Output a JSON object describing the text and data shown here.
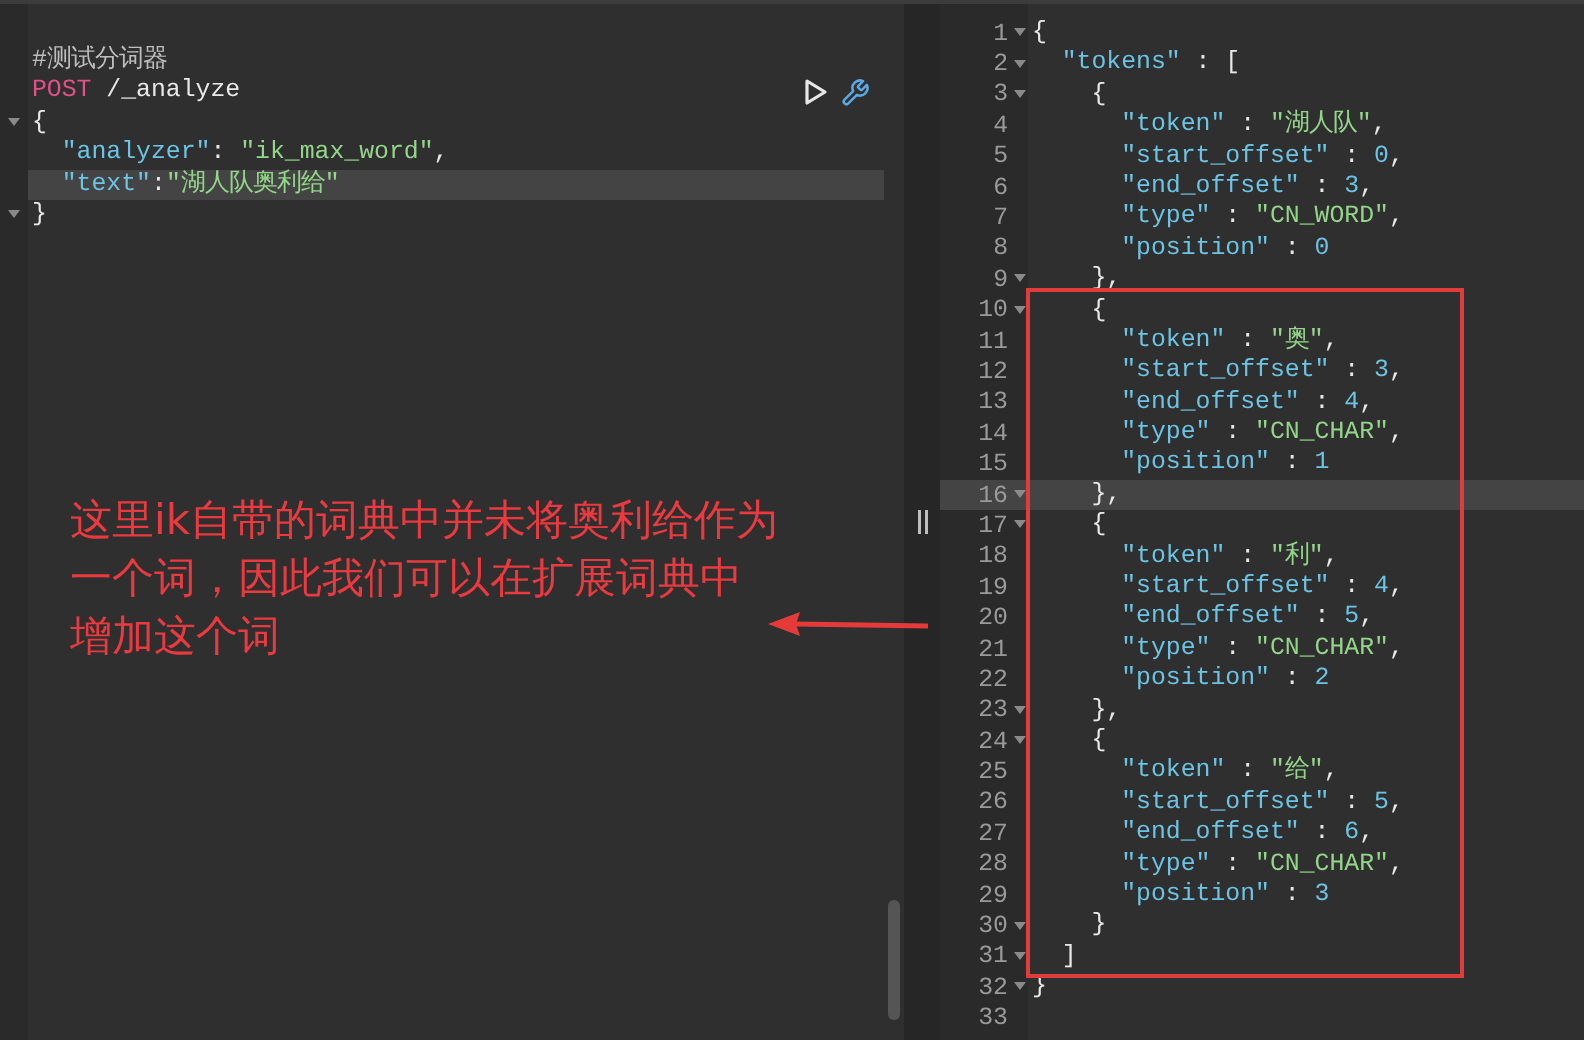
{
  "request": {
    "lines": [
      {
        "fold": false,
        "active": false,
        "parts": [
          {
            "kind": "comment",
            "text": "#测试分词器"
          }
        ]
      },
      {
        "fold": false,
        "active": false,
        "parts": [
          {
            "kind": "method",
            "text": "POST"
          },
          {
            "kind": "punct",
            "text": " /_analyze"
          }
        ]
      },
      {
        "fold": true,
        "active": false,
        "parts": [
          {
            "kind": "punct",
            "text": "{"
          }
        ]
      },
      {
        "fold": false,
        "active": false,
        "parts": [
          {
            "kind": "key",
            "text": "  \"analyzer\""
          },
          {
            "kind": "punct",
            "text": ": "
          },
          {
            "kind": "string",
            "text": "\"ik_max_word\""
          },
          {
            "kind": "punct",
            "text": ","
          }
        ]
      },
      {
        "fold": false,
        "active": true,
        "parts": [
          {
            "kind": "key",
            "text": "  \"text\""
          },
          {
            "kind": "punct",
            "text": ":"
          },
          {
            "kind": "string",
            "text": "\"湖人队奥利给\""
          }
        ]
      },
      {
        "fold": true,
        "active": false,
        "parts": [
          {
            "kind": "punct",
            "text": "}"
          }
        ]
      }
    ]
  },
  "annotation": {
    "lines": [
      "这里ik自带的词典中并未将奥利给作为",
      "一个词，因此我们可以在扩展词典中",
      "增加这个词"
    ]
  },
  "response": {
    "lines": [
      {
        "n": "1",
        "fold": true,
        "active": false,
        "parts": [
          {
            "kind": "punct",
            "text": "{"
          }
        ]
      },
      {
        "n": "2",
        "fold": true,
        "active": false,
        "parts": [
          {
            "kind": "key",
            "text": "  \"tokens\""
          },
          {
            "kind": "punct",
            "text": " : ["
          }
        ]
      },
      {
        "n": "3",
        "fold": true,
        "active": false,
        "parts": [
          {
            "kind": "punct",
            "text": "    {"
          }
        ]
      },
      {
        "n": "4",
        "fold": false,
        "active": false,
        "parts": [
          {
            "kind": "key",
            "text": "      \"token\""
          },
          {
            "kind": "punct",
            "text": " : "
          },
          {
            "kind": "string",
            "text": "\"湖人队\""
          },
          {
            "kind": "punct",
            "text": ","
          }
        ]
      },
      {
        "n": "5",
        "fold": false,
        "active": false,
        "parts": [
          {
            "kind": "key",
            "text": "      \"start_offset\""
          },
          {
            "kind": "punct",
            "text": " : "
          },
          {
            "kind": "number",
            "text": "0"
          },
          {
            "kind": "punct",
            "text": ","
          }
        ]
      },
      {
        "n": "6",
        "fold": false,
        "active": false,
        "parts": [
          {
            "kind": "key",
            "text": "      \"end_offset\""
          },
          {
            "kind": "punct",
            "text": " : "
          },
          {
            "kind": "number",
            "text": "3"
          },
          {
            "kind": "punct",
            "text": ","
          }
        ]
      },
      {
        "n": "7",
        "fold": false,
        "active": false,
        "parts": [
          {
            "kind": "key",
            "text": "      \"type\""
          },
          {
            "kind": "punct",
            "text": " : "
          },
          {
            "kind": "string",
            "text": "\"CN_WORD\""
          },
          {
            "kind": "punct",
            "text": ","
          }
        ]
      },
      {
        "n": "8",
        "fold": false,
        "active": false,
        "parts": [
          {
            "kind": "key",
            "text": "      \"position\""
          },
          {
            "kind": "punct",
            "text": " : "
          },
          {
            "kind": "number",
            "text": "0"
          }
        ]
      },
      {
        "n": "9",
        "fold": true,
        "active": false,
        "parts": [
          {
            "kind": "punct",
            "text": "    },"
          }
        ]
      },
      {
        "n": "10",
        "fold": true,
        "active": false,
        "parts": [
          {
            "kind": "punct",
            "text": "    {"
          }
        ]
      },
      {
        "n": "11",
        "fold": false,
        "active": false,
        "parts": [
          {
            "kind": "key",
            "text": "      \"token\""
          },
          {
            "kind": "punct",
            "text": " : "
          },
          {
            "kind": "string",
            "text": "\"奥\""
          },
          {
            "kind": "punct",
            "text": ","
          }
        ]
      },
      {
        "n": "12",
        "fold": false,
        "active": false,
        "parts": [
          {
            "kind": "key",
            "text": "      \"start_offset\""
          },
          {
            "kind": "punct",
            "text": " : "
          },
          {
            "kind": "number",
            "text": "3"
          },
          {
            "kind": "punct",
            "text": ","
          }
        ]
      },
      {
        "n": "13",
        "fold": false,
        "active": false,
        "parts": [
          {
            "kind": "key",
            "text": "      \"end_offset\""
          },
          {
            "kind": "punct",
            "text": " : "
          },
          {
            "kind": "number",
            "text": "4"
          },
          {
            "kind": "punct",
            "text": ","
          }
        ]
      },
      {
        "n": "14",
        "fold": false,
        "active": false,
        "parts": [
          {
            "kind": "key",
            "text": "      \"type\""
          },
          {
            "kind": "punct",
            "text": " : "
          },
          {
            "kind": "string",
            "text": "\"CN_CHAR\""
          },
          {
            "kind": "punct",
            "text": ","
          }
        ]
      },
      {
        "n": "15",
        "fold": false,
        "active": false,
        "parts": [
          {
            "kind": "key",
            "text": "      \"position\""
          },
          {
            "kind": "punct",
            "text": " : "
          },
          {
            "kind": "number",
            "text": "1"
          }
        ]
      },
      {
        "n": "16",
        "fold": true,
        "active": true,
        "parts": [
          {
            "kind": "punct",
            "text": "    },"
          }
        ]
      },
      {
        "n": "17",
        "fold": true,
        "active": false,
        "parts": [
          {
            "kind": "punct",
            "text": "    {"
          }
        ]
      },
      {
        "n": "18",
        "fold": false,
        "active": false,
        "parts": [
          {
            "kind": "key",
            "text": "      \"token\""
          },
          {
            "kind": "punct",
            "text": " : "
          },
          {
            "kind": "string",
            "text": "\"利\""
          },
          {
            "kind": "punct",
            "text": ","
          }
        ]
      },
      {
        "n": "19",
        "fold": false,
        "active": false,
        "parts": [
          {
            "kind": "key",
            "text": "      \"start_offset\""
          },
          {
            "kind": "punct",
            "text": " : "
          },
          {
            "kind": "number",
            "text": "4"
          },
          {
            "kind": "punct",
            "text": ","
          }
        ]
      },
      {
        "n": "20",
        "fold": false,
        "active": false,
        "parts": [
          {
            "kind": "key",
            "text": "      \"end_offset\""
          },
          {
            "kind": "punct",
            "text": " : "
          },
          {
            "kind": "number",
            "text": "5"
          },
          {
            "kind": "punct",
            "text": ","
          }
        ]
      },
      {
        "n": "21",
        "fold": false,
        "active": false,
        "parts": [
          {
            "kind": "key",
            "text": "      \"type\""
          },
          {
            "kind": "punct",
            "text": " : "
          },
          {
            "kind": "string",
            "text": "\"CN_CHAR\""
          },
          {
            "kind": "punct",
            "text": ","
          }
        ]
      },
      {
        "n": "22",
        "fold": false,
        "active": false,
        "parts": [
          {
            "kind": "key",
            "text": "      \"position\""
          },
          {
            "kind": "punct",
            "text": " : "
          },
          {
            "kind": "number",
            "text": "2"
          }
        ]
      },
      {
        "n": "23",
        "fold": true,
        "active": false,
        "parts": [
          {
            "kind": "punct",
            "text": "    },"
          }
        ]
      },
      {
        "n": "24",
        "fold": true,
        "active": false,
        "parts": [
          {
            "kind": "punct",
            "text": "    {"
          }
        ]
      },
      {
        "n": "25",
        "fold": false,
        "active": false,
        "parts": [
          {
            "kind": "key",
            "text": "      \"token\""
          },
          {
            "kind": "punct",
            "text": " : "
          },
          {
            "kind": "string",
            "text": "\"给\""
          },
          {
            "kind": "punct",
            "text": ","
          }
        ]
      },
      {
        "n": "26",
        "fold": false,
        "active": false,
        "parts": [
          {
            "kind": "key",
            "text": "      \"start_offset\""
          },
          {
            "kind": "punct",
            "text": " : "
          },
          {
            "kind": "number",
            "text": "5"
          },
          {
            "kind": "punct",
            "text": ","
          }
        ]
      },
      {
        "n": "27",
        "fold": false,
        "active": false,
        "parts": [
          {
            "kind": "key",
            "text": "      \"end_offset\""
          },
          {
            "kind": "punct",
            "text": " : "
          },
          {
            "kind": "number",
            "text": "6"
          },
          {
            "kind": "punct",
            "text": ","
          }
        ]
      },
      {
        "n": "28",
        "fold": false,
        "active": false,
        "parts": [
          {
            "kind": "key",
            "text": "      \"type\""
          },
          {
            "kind": "punct",
            "text": " : "
          },
          {
            "kind": "string",
            "text": "\"CN_CHAR\""
          },
          {
            "kind": "punct",
            "text": ","
          }
        ]
      },
      {
        "n": "29",
        "fold": false,
        "active": false,
        "parts": [
          {
            "kind": "key",
            "text": "      \"position\""
          },
          {
            "kind": "punct",
            "text": " : "
          },
          {
            "kind": "number",
            "text": "3"
          }
        ]
      },
      {
        "n": "30",
        "fold": true,
        "active": false,
        "parts": [
          {
            "kind": "punct",
            "text": "    }"
          }
        ]
      },
      {
        "n": "31",
        "fold": true,
        "active": false,
        "parts": [
          {
            "kind": "punct",
            "text": "  ]"
          }
        ]
      },
      {
        "n": "32",
        "fold": true,
        "active": false,
        "parts": [
          {
            "kind": "punct",
            "text": "}"
          }
        ]
      },
      {
        "n": "33",
        "fold": false,
        "active": false
      }
    ]
  }
}
